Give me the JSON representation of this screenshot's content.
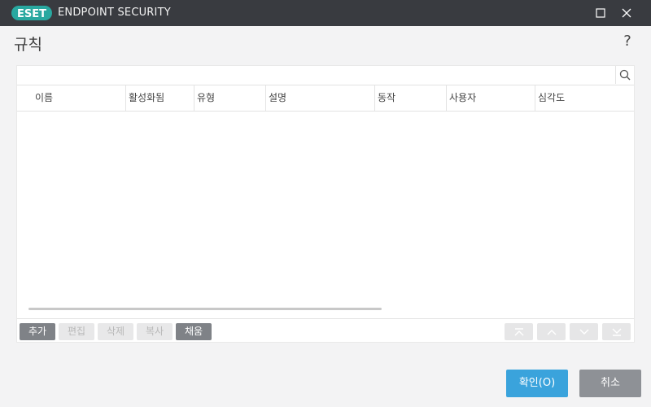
{
  "window": {
    "brand": "ESET",
    "product": "ENDPOINT SECURITY",
    "icons": {
      "maximize": "maximize-icon",
      "close": "close-icon"
    }
  },
  "page": {
    "title": "규칙",
    "help": "?"
  },
  "search": {
    "value": "",
    "icon": "search-icon"
  },
  "table": {
    "columns": [
      "이름",
      "활성화됨",
      "유형",
      "설명",
      "동작",
      "사용자",
      "심각도"
    ],
    "rows": []
  },
  "toolbar": {
    "add": "추가",
    "edit": "편집",
    "delete": "삭제",
    "copy": "복사",
    "populate": "채움",
    "icons": [
      "move-top-icon",
      "move-up-icon",
      "move-down-icon",
      "move-bottom-icon"
    ]
  },
  "footer": {
    "ok": "확인(O)",
    "cancel": "취소"
  },
  "colors": {
    "titlebar": "#393b40",
    "brand": "#29a8a0",
    "primary_button": "#3aa3dc",
    "secondary_button": "#8e9196",
    "active_tool": "#7f8287",
    "disabled_tool": "#e8e8e9"
  }
}
